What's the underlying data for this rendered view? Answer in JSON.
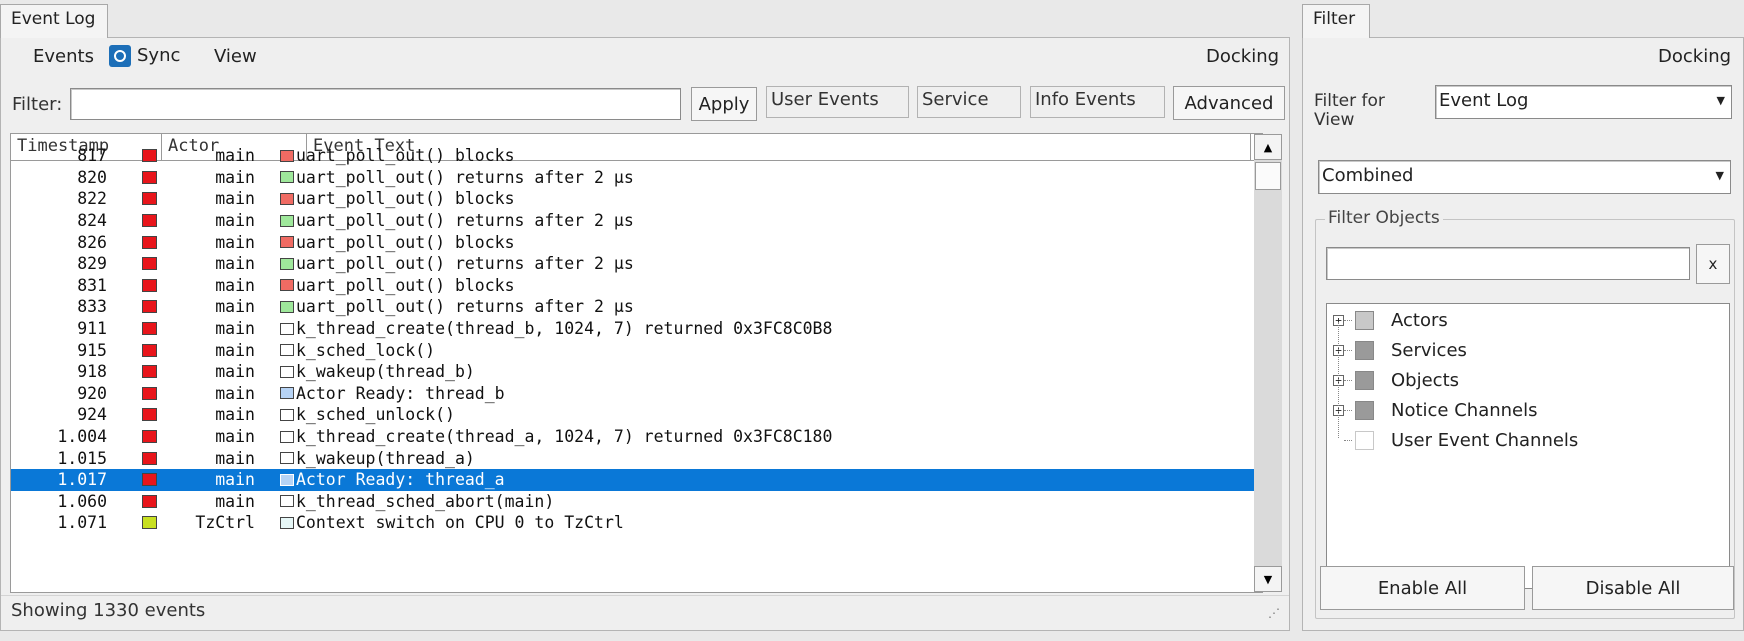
{
  "event_log": {
    "tab_label": "Event Log",
    "menu": {
      "events": "Events",
      "sync": "Sync",
      "view": "View",
      "docking": "Docking"
    },
    "filter": {
      "label": "Filter:",
      "value": "",
      "apply": "Apply",
      "user_events": "User Events",
      "service": "Service",
      "info_events": "Info Events",
      "advanced": "Advanced"
    },
    "columns": {
      "timestamp": "Timestamp",
      "actor": "Actor",
      "event_text": "Event Text"
    },
    "rows": [
      {
        "ts": "817",
        "actor": "main",
        "color": "#e8151b",
        "text": "uart_poll_out() blocks",
        "tcolor": "#f06b63"
      },
      {
        "ts": "820",
        "actor": "main",
        "color": "#e8151b",
        "text": "uart_poll_out() returns after 2 µs",
        "tcolor": "#9fe89b"
      },
      {
        "ts": "822",
        "actor": "main",
        "color": "#e8151b",
        "text": "uart_poll_out() blocks",
        "tcolor": "#f06b63"
      },
      {
        "ts": "824",
        "actor": "main",
        "color": "#e8151b",
        "text": "uart_poll_out() returns after 2 µs",
        "tcolor": "#9fe89b"
      },
      {
        "ts": "826",
        "actor": "main",
        "color": "#e8151b",
        "text": "uart_poll_out() blocks",
        "tcolor": "#f06b63"
      },
      {
        "ts": "829",
        "actor": "main",
        "color": "#e8151b",
        "text": "uart_poll_out() returns after 2 µs",
        "tcolor": "#9fe89b"
      },
      {
        "ts": "831",
        "actor": "main",
        "color": "#e8151b",
        "text": "uart_poll_out() blocks",
        "tcolor": "#f06b63"
      },
      {
        "ts": "833",
        "actor": "main",
        "color": "#e8151b",
        "text": "uart_poll_out() returns after 2 µs",
        "tcolor": "#9fe89b"
      },
      {
        "ts": "911",
        "actor": "main",
        "color": "#e8151b",
        "text": "k_thread_create(thread_b, 1024, 7) returned 0x3FC8C0B8",
        "tcolor": "#ffffff"
      },
      {
        "ts": "915",
        "actor": "main",
        "color": "#e8151b",
        "text": "k_sched_lock()",
        "tcolor": "#ffffff"
      },
      {
        "ts": "918",
        "actor": "main",
        "color": "#e8151b",
        "text": "k_wakeup(thread_b)",
        "tcolor": "#ffffff"
      },
      {
        "ts": "920",
        "actor": "main",
        "color": "#e8151b",
        "text": "Actor Ready: thread_b",
        "tcolor": "#b6d3f5"
      },
      {
        "ts": "924",
        "actor": "main",
        "color": "#e8151b",
        "text": "k_sched_unlock()",
        "tcolor": "#ffffff"
      },
      {
        "ts": "1.004",
        "actor": "main",
        "color": "#e8151b",
        "text": "k_thread_create(thread_a, 1024, 7) returned 0x3FC8C180",
        "tcolor": "#ffffff"
      },
      {
        "ts": "1.015",
        "actor": "main",
        "color": "#e8151b",
        "text": "k_wakeup(thread_a)",
        "tcolor": "#ffffff"
      },
      {
        "ts": "1.017",
        "actor": "main",
        "color": "#e8151b",
        "text": "Actor Ready: thread_a",
        "tcolor": "#b6d3f5",
        "selected": true
      },
      {
        "ts": "1.060",
        "actor": "main",
        "color": "#e8151b",
        "text": "k_thread_sched_abort(main)",
        "tcolor": "#ffffff"
      },
      {
        "ts": "1.071",
        "actor": "TzCtrl",
        "color": "#c8e021",
        "text": "Context switch on CPU 0 to TzCtrl",
        "tcolor": "#e6f7f7"
      }
    ],
    "status": "Showing 1330 events"
  },
  "filter_panel": {
    "tab_label": "Filter",
    "docking": "Docking",
    "filter_for_view_label": "Filter for View",
    "view_select": "Event Log",
    "mode_select": "Combined",
    "filter_objects_label": "Filter Objects",
    "search_value": "",
    "clear_label": "x",
    "tree": [
      {
        "label": "Actors",
        "state": "light",
        "expandable": true
      },
      {
        "label": "Services",
        "state": "filled",
        "expandable": true
      },
      {
        "label": "Objects",
        "state": "filled",
        "expandable": true
      },
      {
        "label": "Notice Channels",
        "state": "filled",
        "expandable": true
      },
      {
        "label": "User Event Channels",
        "state": "empty",
        "expandable": false
      }
    ],
    "enable_all": "Enable All",
    "disable_all": "Disable All"
  }
}
